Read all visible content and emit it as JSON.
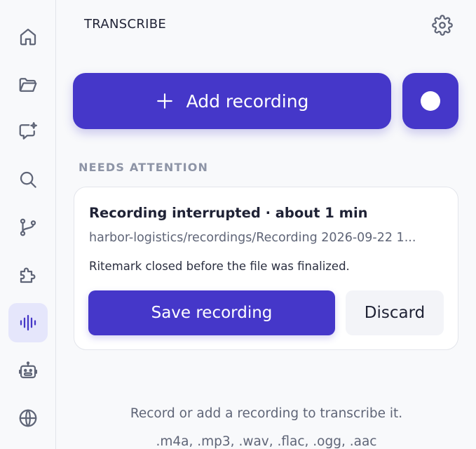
{
  "sidebar": {
    "items": [
      {
        "name": "home",
        "icon": "home-icon",
        "active": false
      },
      {
        "name": "files",
        "icon": "folder-icon",
        "active": false
      },
      {
        "name": "chat",
        "icon": "chat-sparkle-icon",
        "active": false
      },
      {
        "name": "search",
        "icon": "search-icon",
        "active": false
      },
      {
        "name": "source-control",
        "icon": "git-branch-icon",
        "active": false
      },
      {
        "name": "extensions",
        "icon": "puzzle-icon",
        "active": false
      },
      {
        "name": "transcribe",
        "icon": "waveform-icon",
        "active": true
      },
      {
        "name": "bot",
        "icon": "robot-icon",
        "active": false
      },
      {
        "name": "web",
        "icon": "globe-icon",
        "active": false
      }
    ]
  },
  "panel": {
    "title": "TRANSCRIBE",
    "settings_icon": "gear-icon"
  },
  "actions": {
    "add_label": "Add recording",
    "add_icon": "plus-icon",
    "record_icon": "record-dot-icon"
  },
  "attention": {
    "section_label": "NEEDS ATTENTION",
    "card": {
      "title": "Recording interrupted · about 1 min",
      "path": "harbor-logistics/recordings/Recording 2026-09-22 1...",
      "message": "Ritemark closed before the file was finalized.",
      "save_label": "Save recording",
      "discard_label": "Discard"
    }
  },
  "hint": {
    "line1": "Record or add a recording to transcribe it.",
    "line2": ".m4a, .mp3, .wav, .flac, .ogg, .aac"
  },
  "colors": {
    "accent": "#4537c9",
    "active_bg": "#e5e6fb",
    "muted_text": "#8d94a6"
  }
}
